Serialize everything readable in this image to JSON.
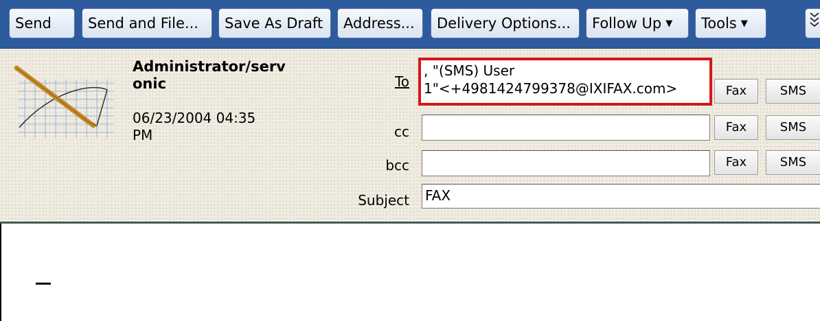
{
  "toolbar": {
    "send": "Send",
    "send_and_file": "Send and File...",
    "save_as_draft": "Save As Draft",
    "address": "Address...",
    "delivery_options": "Delivery Options...",
    "follow_up": "Follow Up",
    "tools": "Tools",
    "more_icon": "double-chevron-down-icon"
  },
  "header": {
    "sender_line1": "Administrator/serv",
    "sender_line2": "onic",
    "date_line1": "06/23/2004 04:35",
    "date_line2": "PM",
    "to_label": "To",
    "cc_label": "cc",
    "bcc_label": "bcc",
    "subject_label": "Subject",
    "to_value_line1": ", \"(SMS) User",
    "to_value_line2": "1\"<+4981424799378@IXIFAX.com>",
    "cc_value": "",
    "bcc_value": "",
    "subject_value": "FAX",
    "fax_label": "Fax",
    "sms_label": "SMS",
    "highlight_color": "#d4161c"
  }
}
